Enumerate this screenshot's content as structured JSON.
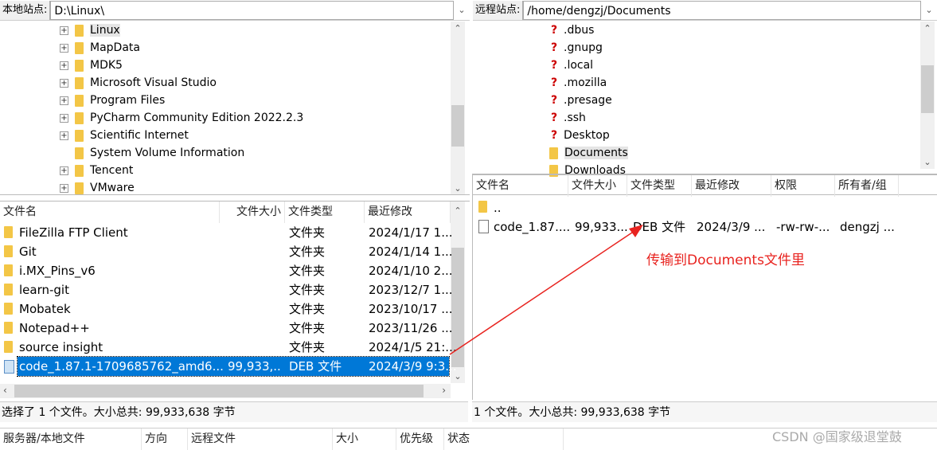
{
  "local": {
    "site_label": "本地站点:",
    "path": "D:\\Linux\\",
    "tree": [
      "Linux",
      "MapData",
      "MDK5",
      "Microsoft Visual Studio",
      "Program Files",
      "PyCharm Community Edition 2022.2.3",
      "Scientific Internet",
      "System Volume Information",
      "Tencent",
      "VMware"
    ],
    "tree_expandable": [
      true,
      true,
      true,
      true,
      true,
      true,
      true,
      false,
      true,
      true
    ],
    "columns": [
      "文件名",
      "文件大小",
      "文件类型",
      "最近修改"
    ],
    "files": [
      {
        "name": "FileZilla FTP Client",
        "size": "",
        "type": "文件夹",
        "modified": "2024/1/17 1..."
      },
      {
        "name": "Git",
        "size": "",
        "type": "文件夹",
        "modified": "2024/1/14 1..."
      },
      {
        "name": "i.MX_Pins_v6",
        "size": "",
        "type": "文件夹",
        "modified": "2024/1/10 2..."
      },
      {
        "name": "learn-git",
        "size": "",
        "type": "文件夹",
        "modified": "2023/12/7 1..."
      },
      {
        "name": "Mobatek",
        "size": "",
        "type": "文件夹",
        "modified": "2023/10/17 ..."
      },
      {
        "name": "Notepad++",
        "size": "",
        "type": "文件夹",
        "modified": "2023/11/26 ..."
      },
      {
        "name": "source insight",
        "size": "",
        "type": "文件夹",
        "modified": "2024/1/5 21:..."
      },
      {
        "name": "code_1.87.1-1709685762_amd6...",
        "size": "99,933,...",
        "type": "DEB 文件",
        "modified": "2024/3/9 9:3...",
        "selected": true
      }
    ],
    "status": "选择了 1 个文件。大小总共: 99,933,638 字节"
  },
  "remote": {
    "site_label": "远程站点:",
    "path": "/home/dengzj/Documents",
    "tree": [
      ".dbus",
      ".gnupg",
      ".local",
      ".mozilla",
      ".presage",
      ".ssh",
      "Desktop",
      "Documents",
      "Downloads"
    ],
    "tree_known": [
      false,
      false,
      false,
      false,
      false,
      false,
      false,
      true,
      true
    ],
    "columns": [
      "文件名",
      "文件大小",
      "文件类型",
      "最近修改",
      "权限",
      "所有者/组"
    ],
    "files": [
      {
        "name": "..",
        "size": "",
        "type": "",
        "modified": "",
        "perm": "",
        "owner": ""
      },
      {
        "name": "code_1.87....",
        "size": "99,933...",
        "type": "DEB 文件",
        "modified": "2024/3/9 ...",
        "perm": "-rw-rw-...",
        "owner": "dengzj ..."
      }
    ],
    "status": "1 个文件。大小总共: 99,933,638 字节"
  },
  "annotation": {
    "text": "传输到Documents文件里",
    "color": "#e8231f"
  },
  "queue": {
    "columns": [
      "服务器/本地文件",
      "方向",
      "远程文件",
      "大小",
      "优先级",
      "状态"
    ]
  },
  "watermark": "CSDN @国家级退堂鼓"
}
